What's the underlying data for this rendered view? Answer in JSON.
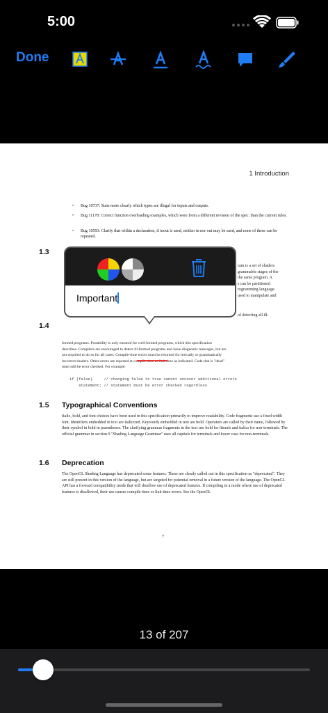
{
  "status": {
    "time": "5:00"
  },
  "toolbar": {
    "done_label": "Done",
    "tools": [
      "highlight-icon",
      "strikethrough-icon",
      "underline-icon",
      "squiggly-underline-icon",
      "note-bubble-icon",
      "pen-icon"
    ],
    "accent": "#1f7cf2",
    "highlight_color": "#e8d800"
  },
  "page": {
    "running_head": "1 Introduction",
    "bullets": [
      "Bug 10737: State more clearly which types are illegal for inputs and outputs.",
      "Bug 11178: Correct function overloading examples, which were from a different revision of the spec. than the current rules.",
      "Bug 10593: Clarify that within a declaration, if inout is used, neither in nor out may be used, and none of these can be repeated."
    ],
    "s13_num": "1.3",
    "s13_lines": [
      "ram is a set of shaders",
      "grammable stages of the",
      "the same program. A",
      "s can be partitioned",
      "rogramming language.",
      "used to manipulate and"
    ],
    "s14_num": "1.4",
    "s14_lines": [
      "of detecting all ill-",
      "formed programs. Portability is only ensured for well-formed programs, which this specification",
      "describes. Compilers are encouraged to detect ill-formed programs and issue diagnostic messages, but are",
      "not required to do so for all cases. Compile-time errors must be returned for lexically or grammatically",
      "incorrect shaders. Other errors are reported at compile time or link time as indicated. Code that is \"dead\"",
      "must still be error checked. For example:"
    ],
    "code_lines": [
      "if (false)     // changing false to true cannot uncover additional errors",
      "    statement; // statement must be error checked regardless"
    ],
    "s15_num": "1.5",
    "s15_title": "Typographical Conventions",
    "s15_text": "Italic, bold, and font choices have been used in this specification primarily to improve readability. Code fragments use a fixed width font. Identifiers embedded in text are italicized. Keywords embedded in text are bold. Operators are called by their name, followed by their symbol in bold in parentheses. The clarifying grammar fragments in the text use bold for literals and italics for non-terminals. The official grammar in section 9 \"Shading Language Grammar\" uses all capitals for terminals and lower case for non-terminals.",
    "s16_num": "1.6",
    "s16_title": "Deprecation",
    "s16_text": "The OpenGL Shading Language has deprecated some features. These are clearly called out in this specification as \"deprecated\". They are still present in this version of the language, but are targeted for potential removal in a future version of the language. The OpenGL API has a forward compatibility mode that will disallow use of deprecated features. If compiling in a mode where use of deprecated features is disallowed, their use causes compile-time or link-time errors. See the OpenGL",
    "page_number": "7"
  },
  "note_popup": {
    "text": "Important",
    "icons": [
      "color-picker-icon",
      "opacity-picker-icon",
      "trash-icon"
    ]
  },
  "footer": {
    "page_counter": "13 of 207",
    "progress": 0.085
  }
}
